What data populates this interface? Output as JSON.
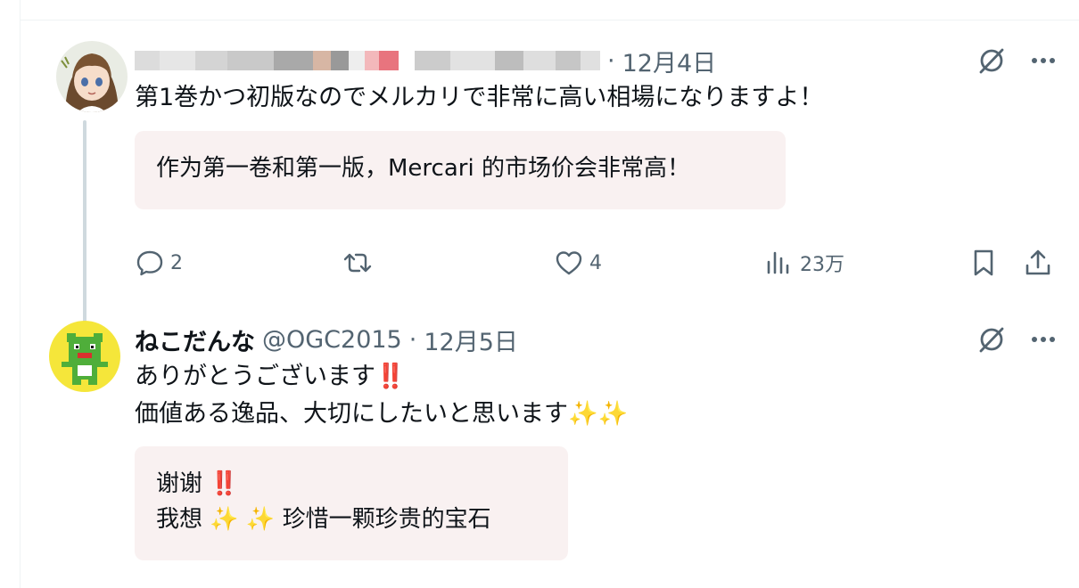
{
  "post1": {
    "date": "12月4日",
    "text": "第1巻かつ初版なのでメルカリで非常に高い相場になりますよ！",
    "translation": "作为第一卷和第一版，Mercari 的市场价会非常高！",
    "actions": {
      "reply_count": "2",
      "like_count": "4",
      "view_count": "23万"
    }
  },
  "post2": {
    "display_name": "ねこだんな",
    "handle": "@OGC2015",
    "date": "12月5日",
    "text_line1": "ありがとうございます",
    "text_line1_emoji": "‼️",
    "text_line2": "価値ある逸品、大切にしたいと思います",
    "text_line2_emoji": "✨✨",
    "translation_line1": "谢谢",
    "translation_line1_emoji": "‼️",
    "translation_line2_prefix": "我想",
    "translation_line2_emoji1": "✨",
    "translation_line2_emoji2": "✨",
    "translation_line2_suffix": "珍惜一颗珍贵的宝石"
  },
  "separator": "·",
  "icons": {
    "grok": "grok-icon",
    "more": "more-icon",
    "reply": "reply-icon",
    "repost": "repost-icon",
    "like": "like-icon",
    "views": "views-icon",
    "bookmark": "bookmark-icon",
    "share": "share-icon"
  },
  "colors": {
    "secondary_text": "#536471",
    "translation_bg": "#f9f1f1",
    "thread_line": "#cfd9de"
  }
}
